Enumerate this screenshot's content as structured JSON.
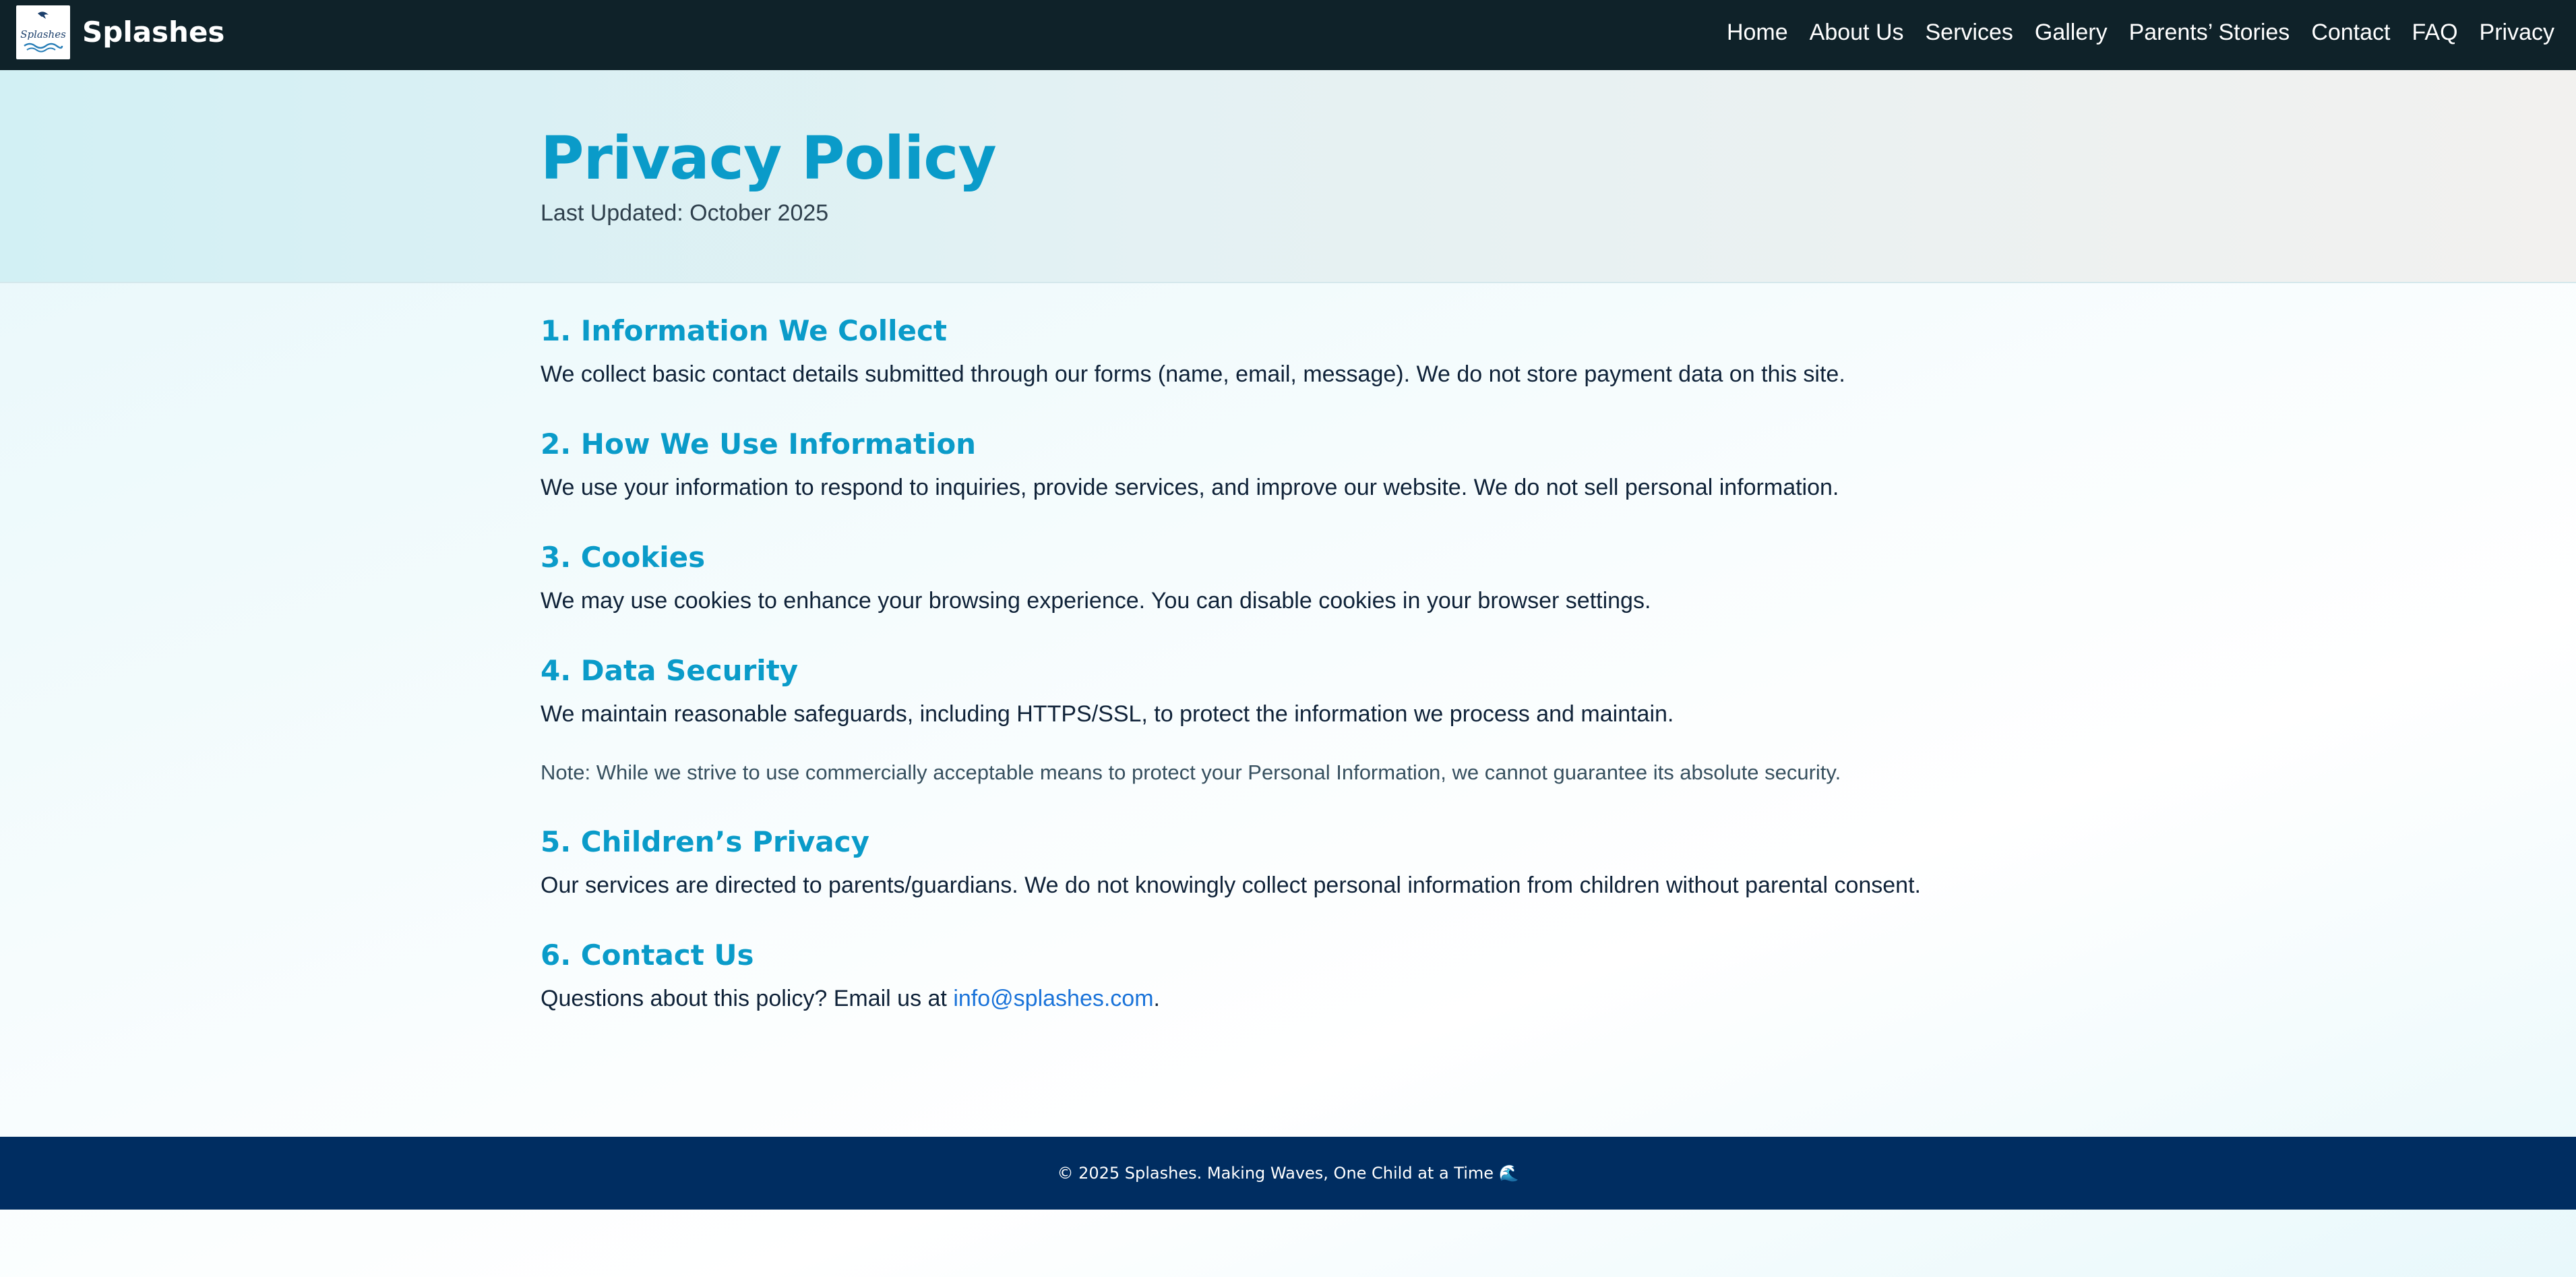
{
  "brand": {
    "name": "Splashes",
    "logo_icon": "splashes-logo-icon",
    "logo_text": "Splashes"
  },
  "nav": {
    "items": [
      {
        "label": "Home"
      },
      {
        "label": "About Us"
      },
      {
        "label": "Services"
      },
      {
        "label": "Gallery"
      },
      {
        "label": "Parents’ Stories"
      },
      {
        "label": "Contact"
      },
      {
        "label": "FAQ"
      },
      {
        "label": "Privacy"
      }
    ]
  },
  "hero": {
    "title": "Privacy Policy",
    "updated": "Last Updated: October 2025"
  },
  "sections": [
    {
      "heading": "1. Information We Collect",
      "body": "We collect basic contact details submitted through our forms (name, email, message). We do not store payment data on this site."
    },
    {
      "heading": "2. How We Use Information",
      "body": "We use your information to respond to inquiries, provide services, and improve our website. We do not sell personal information."
    },
    {
      "heading": "3. Cookies",
      "body": "We may use cookies to enhance your browsing experience. You can disable cookies in your browser settings."
    },
    {
      "heading": "4. Data Security",
      "body": "We maintain reasonable safeguards, including HTTPS/SSL, to protect the information we process and maintain.",
      "note": "Note: While we strive to use commercially acceptable means to protect your Personal Information, we cannot guarantee its absolute security."
    },
    {
      "heading": "5. Children’s Privacy",
      "body": "Our services are directed to parents/guardians. We do not knowingly collect personal information from children without parental consent."
    },
    {
      "heading": "6. Contact Us",
      "body_prefix": "Questions about this policy? Email us at ",
      "email": "info@splashes.com",
      "body_suffix": "."
    }
  ],
  "footer": {
    "text": "© 2025 Splashes. Making Waves, One Child at a Time 🌊"
  },
  "colors": {
    "nav_bg": "#0f2229",
    "accent": "#0a9bc9",
    "footer_bg": "#002d61",
    "link": "#1a73d9"
  }
}
